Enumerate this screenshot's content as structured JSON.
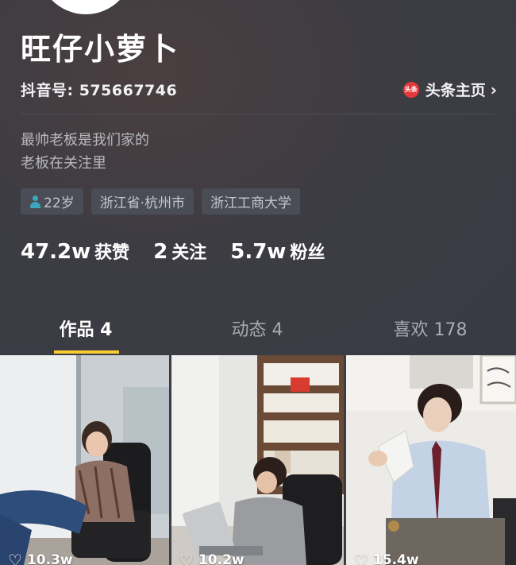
{
  "profile": {
    "name": "旺仔小萝卜",
    "douyin_id": "抖音号: 575667746",
    "toutiao_badge": "头条",
    "toutiao_link": "头条主页",
    "bio_line1": "最帅老板是我们家的",
    "bio_line2": "老板在关注里",
    "tags": {
      "age": "22岁",
      "location": "浙江省·杭州市",
      "school": "浙江工商大学"
    },
    "stats": {
      "likes_value": "47.2w",
      "likes_label": "获赞",
      "following_value": "2",
      "following_label": "关注",
      "followers_value": "5.7w",
      "followers_label": "粉丝"
    }
  },
  "tabs": {
    "works": "作品 4",
    "dynamics": "动态 4",
    "favorites": "喜欢 178"
  },
  "videos": [
    {
      "likes": "10.3w"
    },
    {
      "likes": "10.2w"
    },
    {
      "likes": "15.4w"
    }
  ],
  "colors": {
    "background": "#3a3d45",
    "accent_underline": "#facc33",
    "toutiao_red": "#e4393c"
  }
}
